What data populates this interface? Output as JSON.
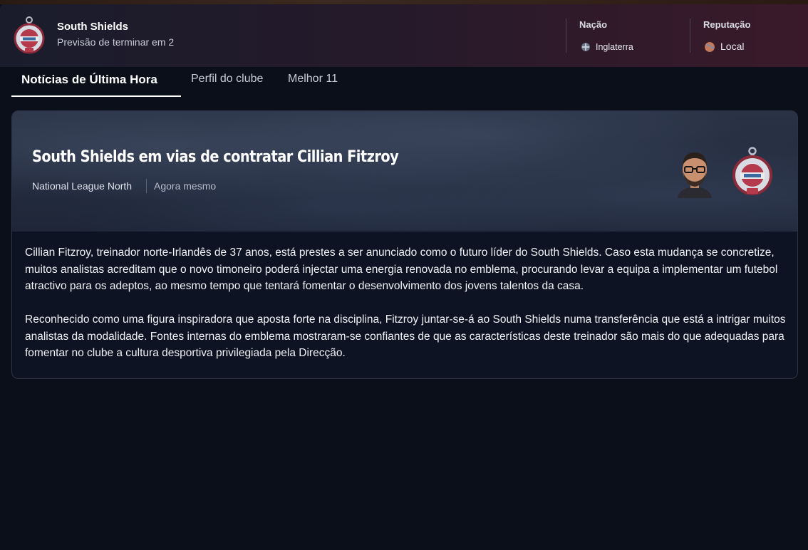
{
  "header": {
    "club_name": "South Shields",
    "club_subtitle": "Previsão de terminar em 2",
    "nation_label": "Nação",
    "nation_value": "Inglaterra",
    "reputation_label": "Reputação",
    "reputation_value": "Local"
  },
  "tabs": [
    {
      "label": "Notícias de Última Hora",
      "active": true
    },
    {
      "label": "Perfil do clube",
      "active": false
    },
    {
      "label": "Melhor 11",
      "active": false
    }
  ],
  "news": {
    "headline": "South Shields em vias de contratar Cillian Fitzroy",
    "league": "National League North",
    "time": "Agora mesmo",
    "paragraphs": [
      "Cillian Fitzroy, treinador norte-Irlandês de 37 anos, está prestes a ser anunciado como o futuro líder do South Shields. Caso esta mudança se concretize, muitos analistas acreditam que o novo timoneiro poderá injectar uma energia renovada no emblema, procurando levar a equipa a implementar um futebol atractivo para os adeptos, ao mesmo tempo que tentará fomentar o desenvolvimento dos jovens talentos da casa.",
      "Reconhecido como uma figura inspiradora que aposta forte na disciplina, Fitzroy juntar-se-á ao South Shields numa transferência que está a intrigar muitos analistas da modalidade. Fontes internas do emblema mostraram-se confiantes de que as características deste treinador são mais do que adequadas para fomentar no clube a cultura desportiva privilegiada pela Direcção."
    ]
  },
  "colors": {
    "background": "#0b0f1a",
    "header_gradient_end": "#3a1a2a",
    "banner": "#2a3346",
    "text": "#f1f2f6"
  },
  "icons": {
    "club_crest": "club-crest-icon",
    "nation_flag": "england-flag-icon",
    "reputation": "reputation-globe-icon",
    "manager_portrait": "manager-portrait",
    "club_badge": "club-badge-icon"
  }
}
